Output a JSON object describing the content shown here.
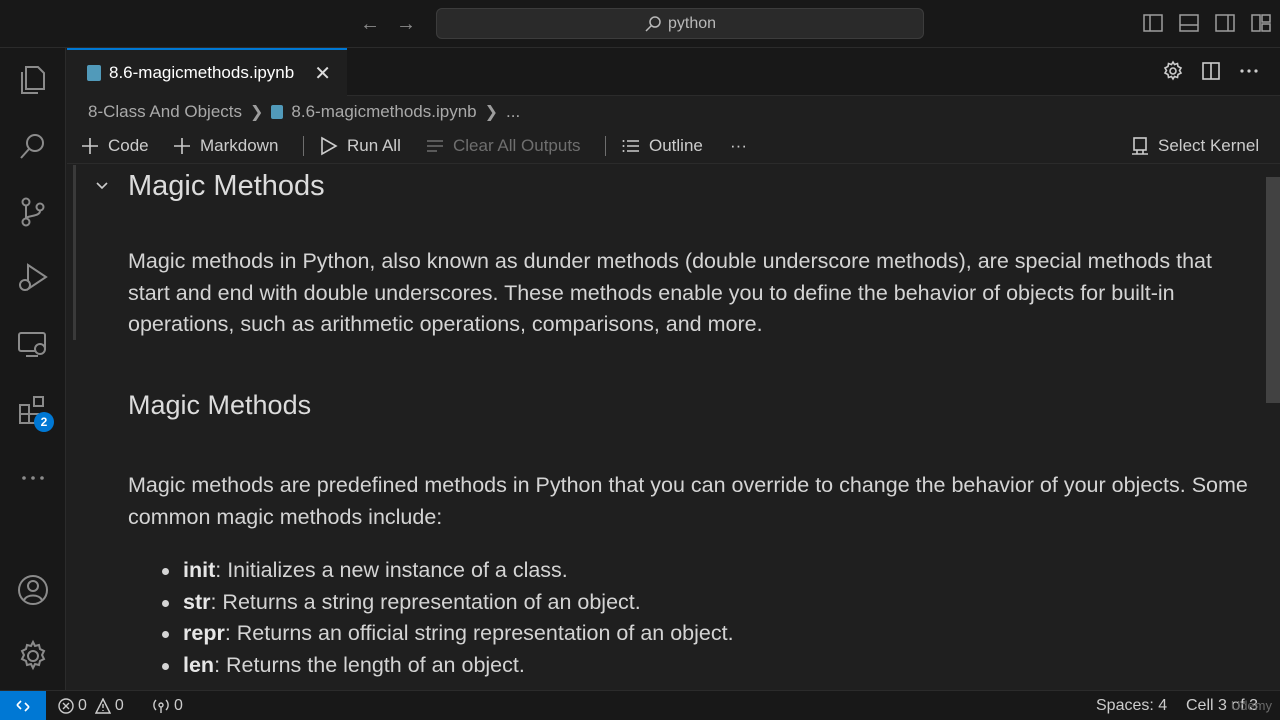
{
  "titlebar": {
    "search_text": "python"
  },
  "activitybar": {
    "extensions_badge": "2"
  },
  "tab": {
    "filename": "8.6-magicmethods.ipynb"
  },
  "breadcrumb": {
    "folder": "8-Class And Objects",
    "file": "8.6-magicmethods.ipynb",
    "more": "..."
  },
  "toolbar": {
    "code_label": "Code",
    "markdown_label": "Markdown",
    "run_all_label": "Run All",
    "clear_outputs_label": "Clear All Outputs",
    "outline_label": "Outline",
    "more_label": "···",
    "kernel_label": "Select Kernel"
  },
  "notebook": {
    "heading1": "Magic Methods",
    "paragraph1": "Magic methods in Python, also known as dunder methods (double underscore methods), are special methods that start and end with double underscores. These methods enable you to define the behavior of objects for built-in operations, such as arithmetic operations, comparisons, and more.",
    "heading2": "Magic Methods",
    "paragraph2": "Magic methods are predefined methods in Python that you can override to change the behavior of your objects. Some common magic methods include:",
    "items": [
      {
        "name": "init",
        "desc": ": Initializes a new instance of a class."
      },
      {
        "name": "str",
        "desc": ": Returns a string representation of an object."
      },
      {
        "name": "repr",
        "desc": ": Returns an official string representation of an object."
      },
      {
        "name": "len",
        "desc": ": Returns the length of an object."
      }
    ]
  },
  "statusbar": {
    "errors": "0",
    "warnings": "0",
    "ports": "0",
    "spaces": "Spaces: 4",
    "cell": "Cell 3 of 3",
    "watermark": "Udemy"
  },
  "colors": {
    "accent": "#0078d4",
    "background": "#1f1f1f",
    "sidebar": "#181818"
  }
}
